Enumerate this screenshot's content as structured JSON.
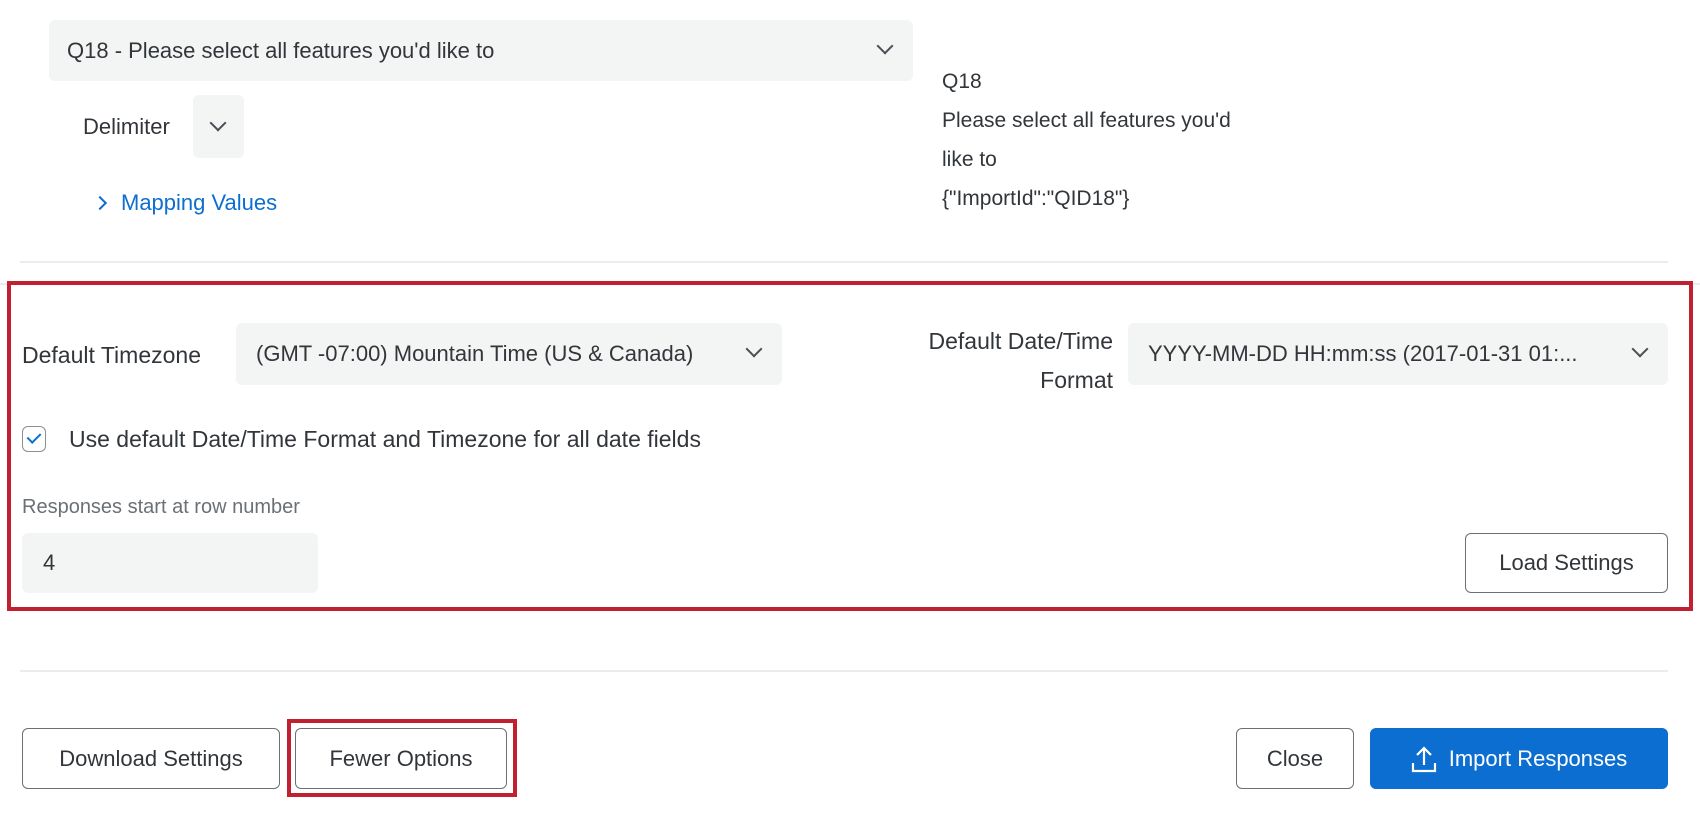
{
  "question_select": {
    "value": "Q18 - Please select all features you'd like to"
  },
  "delimiter": {
    "label": "Delimiter"
  },
  "mapping_values": {
    "label": "Mapping Values"
  },
  "question_info": {
    "id": "Q18",
    "text_line1": "Please select all features you'd",
    "text_line2": "like to",
    "import_id": "{\"ImportId\":\"QID18\"}"
  },
  "settings": {
    "timezone_label": "Default Timezone",
    "timezone_value": "(GMT -07:00) Mountain Time (US & Canada)",
    "datetime_label_line1": "Default Date/Time",
    "datetime_label_line2": "Format",
    "datetime_value": "YYYY-MM-DD HH:mm:ss (2017-01-31 01:...",
    "use_default_label": "Use default Date/Time Format and Timezone for all date fields",
    "use_default_checked": true,
    "row_label": "Responses start at row number",
    "row_value": "4",
    "load_settings": "Load Settings"
  },
  "footer": {
    "download_settings": "Download Settings",
    "fewer_options": "Fewer Options",
    "close": "Close",
    "import_responses": "Import Responses"
  },
  "colors": {
    "accent": "#0b6ed0",
    "highlight": "#c0202f"
  }
}
